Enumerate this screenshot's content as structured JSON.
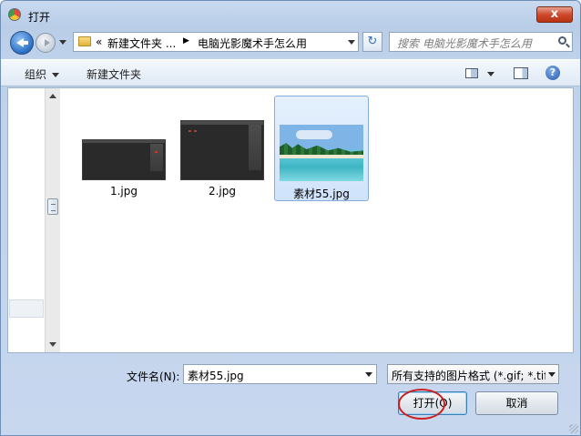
{
  "window": {
    "title": "打开",
    "close_label": "x"
  },
  "nav": {
    "breadcrumb_prefix": "«",
    "breadcrumb_parent": "新建文件夹 ...",
    "breadcrumb_sep": "▶",
    "breadcrumb_current": "电脑光影魔术手怎么用",
    "refresh_glyph": "↻",
    "search_placeholder": "搜索 电脑光影魔术手怎么用"
  },
  "toolbar": {
    "organize_label": "组织",
    "new_folder_label": "新建文件夹",
    "help_glyph": "?"
  },
  "files": [
    {
      "name": "1.jpg",
      "thumb": "dark-screenshot",
      "selected": false
    },
    {
      "name": "2.jpg",
      "thumb": "dark-screenshot",
      "selected": false
    },
    {
      "name": "素材55.jpg",
      "thumb": "beach-photo",
      "selected": true
    }
  ],
  "bottom": {
    "filename_label": "文件名(N):",
    "filename_value": "素材55.jpg",
    "filetype_value": "所有支持的图片格式 (*.gif; *.tif",
    "open_label": "打开(O)",
    "cancel_label": "取消"
  },
  "colors": {
    "frame": "#bfd2ea",
    "selection": "#cfe3fb",
    "annotation": "#cc1f1f"
  }
}
